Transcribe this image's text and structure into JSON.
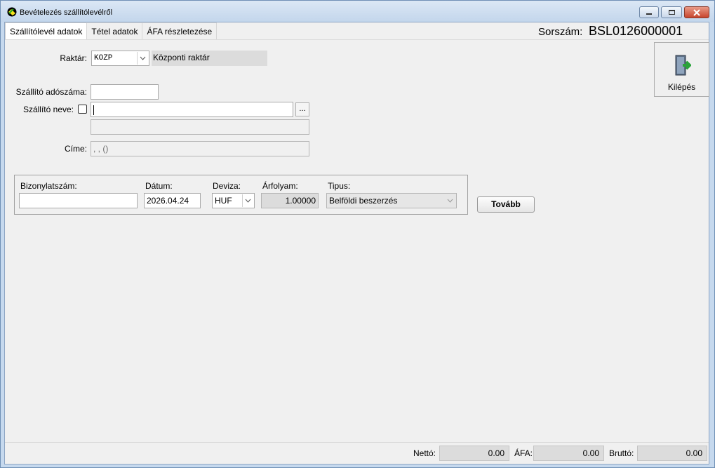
{
  "window": {
    "title": "Bevételezés szállítólevélről"
  },
  "tabs": [
    {
      "label": "Szállítólevél adatok",
      "active": true
    },
    {
      "label": "Tétel adatok",
      "active": false
    },
    {
      "label": "ÁFA részletezése",
      "active": false
    }
  ],
  "header": {
    "serial_label": "Sorszám:",
    "serial_value": "BSL0126000001"
  },
  "exit_button": {
    "label": "Kilépés",
    "icon": "exit-door-icon"
  },
  "form": {
    "warehouse_label": "Raktár:",
    "warehouse_code": "KOZP",
    "warehouse_name": "Központi raktár",
    "tax_number_label": "Szállító adószáma:",
    "tax_number_value": "",
    "supplier_name_label": "Szállító neve:",
    "supplier_name_value": "",
    "supplier_name2_value": "",
    "browse_label": "...",
    "address_label": "Címe:",
    "address_value": ", ,  ()"
  },
  "document": {
    "doc_number_label": "Bizonylatszám:",
    "doc_number_value": "",
    "date_label": "Dátum:",
    "date_value": "2026.04.24",
    "currency_label": "Deviza:",
    "currency_value": "HUF",
    "rate_label": "Árfolyam:",
    "rate_value": "1.00000",
    "type_label": "Tipus:",
    "type_value": "Belföldi beszerzés"
  },
  "next_button": {
    "label": "Tovább"
  },
  "totals": {
    "net_label": "Nettó:",
    "net_value": "0.00",
    "vat_label": "ÁFA:",
    "vat_value": "0.00",
    "gross_label": "Bruttó:",
    "gross_value": "0.00"
  },
  "colors": {
    "titlebar": "#c3d6ec",
    "client_bg": "#f0f0f0",
    "exit_arrow": "#2aa33a"
  }
}
